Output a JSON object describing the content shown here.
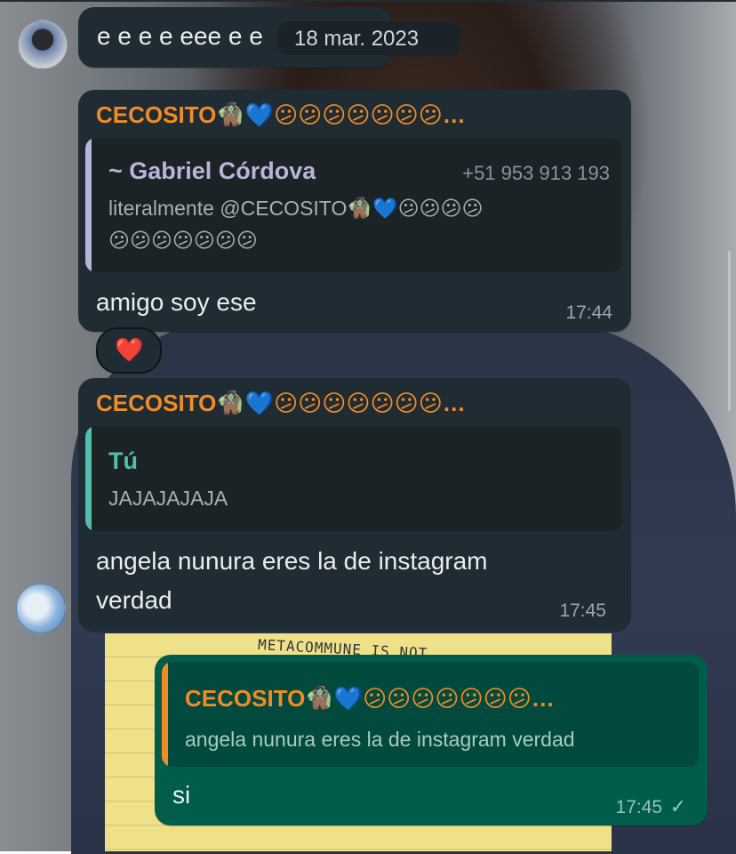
{
  "date_pill": "18 mar. 2023",
  "messages": [
    {
      "text": "e e e e eee e e"
    },
    {
      "sender": "CECOSITO🧌💙😕😕😕😕😕😕😕…",
      "quote": {
        "author": "~ Gabriel Córdova",
        "phone": "+51 953 913 193",
        "line1": "literalmente @CECOSITO🧌💙😕😕😕😕",
        "line2": "😕😕😕😕😕😕😕"
      },
      "text": "amigo soy ese",
      "time": "17:44",
      "reaction": "❤️"
    },
    {
      "sender": "CECOSITO🧌💙😕😕😕😕😕😕😕…",
      "quote": {
        "author": "Tú",
        "text": "JAJAJAJAJA"
      },
      "text_line1": "angela nunura eres la de instagram",
      "text_line2": "verdad",
      "time": "17:45"
    },
    {
      "quote": {
        "author": "CECOSITO🧌💙😕😕😕😕😕😕😕…",
        "text": "angela nunura eres la de instagram verdad"
      },
      "text": "si",
      "time": "17:45",
      "status": "✓"
    }
  ],
  "wallpaper_text": "METACOMMUNE IS NOT",
  "colors": {
    "incoming": "#202c33",
    "outgoing": "#005c4b",
    "sender": "#f28b24",
    "accent_you": "#53bdae",
    "accent_gabriel": "#b7b5d9"
  }
}
